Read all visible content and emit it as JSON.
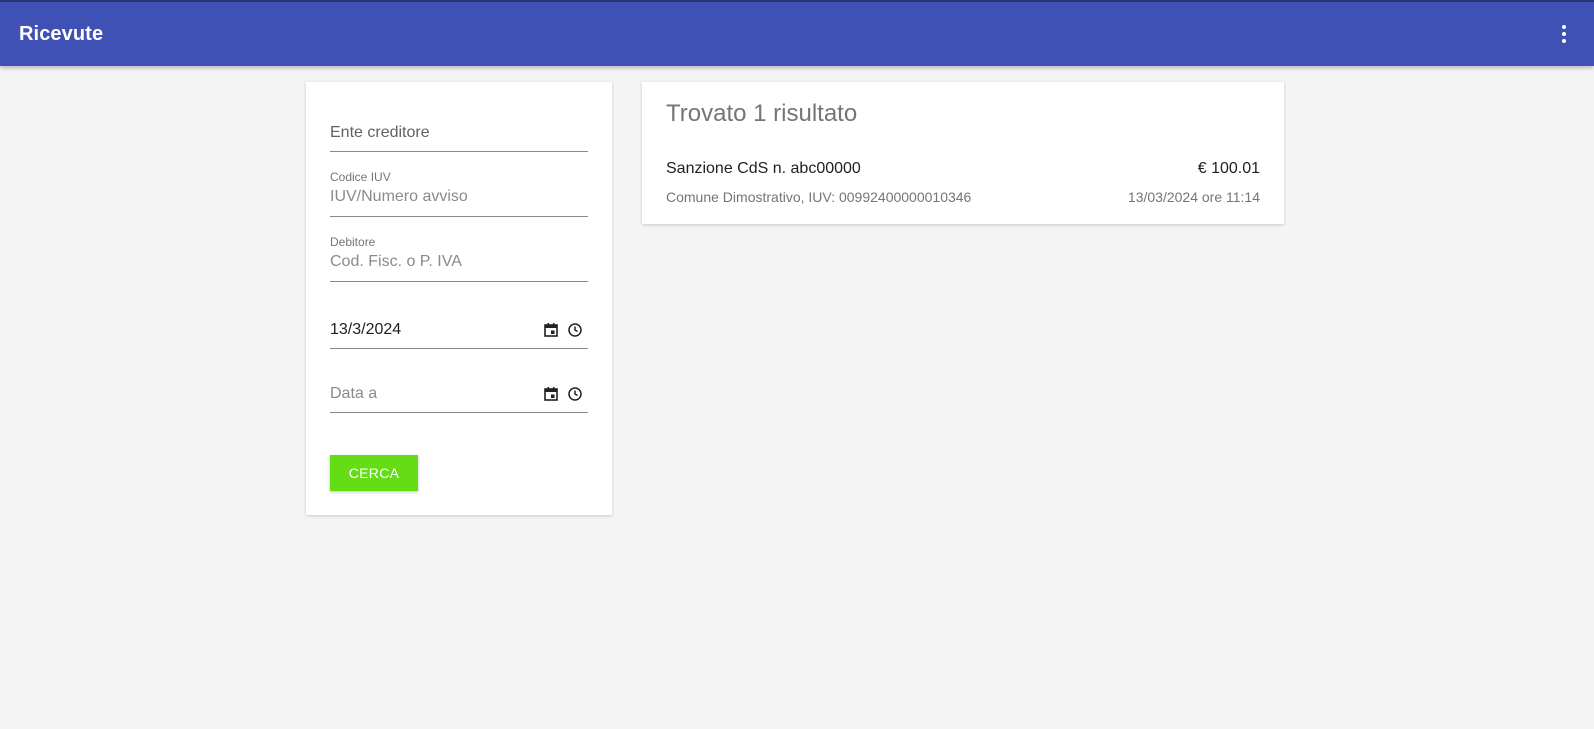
{
  "appbar": {
    "title": "Ricevute",
    "menu_icon": "more-vert-icon",
    "color": "#3f51b5"
  },
  "filters": {
    "ente_creditore": {
      "placeholder": "Ente creditore",
      "value": ""
    },
    "codice_iuv": {
      "label": "Codice IUV",
      "placeholder": "IUV/Numero avviso",
      "value": ""
    },
    "debitore": {
      "label": "Debitore",
      "placeholder": "Cod. Fisc. o P. IVA",
      "value": ""
    },
    "data_da": {
      "value": "13/3/2024",
      "icons": [
        "calendar-icon",
        "clock-icon"
      ]
    },
    "data_a": {
      "placeholder": "Data a",
      "value": "",
      "icons": [
        "calendar-icon",
        "clock-icon"
      ]
    },
    "search_button": {
      "label": "CERCA",
      "color": "#64dd17"
    }
  },
  "results": {
    "title": "Trovato 1 risultato",
    "items": [
      {
        "name": "Sanzione CdS n. abc00000",
        "amount": "€ 100.01",
        "detail": "Comune Dimostrativo, IUV: 00992400000010346",
        "date": "13/03/2024 ore 11:14"
      }
    ]
  }
}
